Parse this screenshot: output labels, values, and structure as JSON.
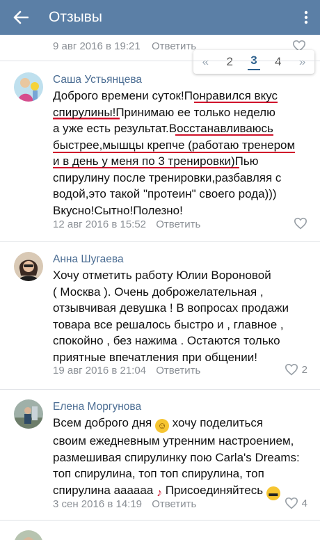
{
  "header": {
    "title": "Отзывы",
    "back_icon": "arrow-left-icon",
    "menu_icon": "more-vertical-icon",
    "bg_color": "#5b7fa6"
  },
  "previous_comment": {
    "date": "9 авг 2016 в 19:21",
    "reply_label": "Ответить"
  },
  "pagination": {
    "prev_label": "«",
    "pages": [
      "2",
      "3",
      "4"
    ],
    "current": "3",
    "next_label": "»"
  },
  "comments": [
    {
      "author": "Саша Устьянцева",
      "lines": [
        "Доброго времени суток!Понравился вкус",
        "спирулины!Принимаю ее только неделю",
        "а уже есть результат.Восстанавливаюсь",
        "быстрее,мышцы крепче (работаю тренером",
        "и в день у меня по 3 тренировки)Пью",
        "спирулину после тренировки,разбавляя с",
        "водой,это такой \"протеин\" своего рода)))",
        "Вкусно!Сытно!Полезно!"
      ],
      "date": "12 авг 2016 в 15:52",
      "reply_label": "Ответить",
      "likes": ""
    },
    {
      "author": "Анна Шугаева",
      "lines": [
        "Хочу отметить работу Юлии Вороновой",
        "( Москва ). Очень доброжелательная ,",
        "отзывчивая девушка ! В вопросах продажи",
        "товара все решалось быстро и , главное ,",
        "спокойно , без нажима . Остаются только",
        "приятные впечатления при общении!"
      ],
      "date": "19 авг 2016 в 21:04",
      "reply_label": "Ответить",
      "likes": "2"
    },
    {
      "author": "Елена Моргунова",
      "lines": [
        "Всем доброго дня",
        "хочу поделиться",
        "своим ежедневным утренним настроением,",
        "размешивая спирулинку пою Carla's Dreams:",
        "топ спирулина, топ топ спирулина, топ",
        "спирулина ааааaa",
        "Присоединяйтесь"
      ],
      "date": "3 сен 2016 в 14:19",
      "reply_label": "Ответить",
      "likes": "4"
    }
  ],
  "colors": {
    "accent": "#4b6d93",
    "highlight_underline": "#d0112b"
  }
}
